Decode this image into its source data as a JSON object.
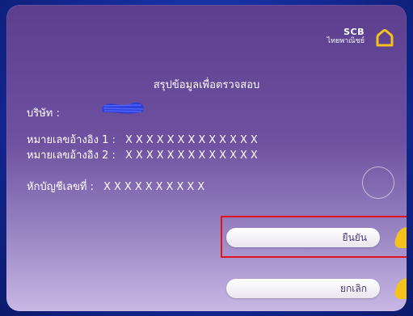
{
  "brand": {
    "name": "SCB",
    "thai_name": "ไทยพาณิชย์",
    "logo_icon": "house-icon"
  },
  "title": "สรุปข้อมูลเพื่อตรวจสอบ",
  "fields": {
    "company_label": "บริษัท :",
    "ref1_label": "หมายเลขอ้างอิง 1 :",
    "ref1_value": "XXXXXXXXXXXXX",
    "ref2_label": "หมายเลขอ้างอิง 2 :",
    "ref2_value": "XXXXXXXXXXXXX",
    "account_label": "หักบัญชีเลขที่ :",
    "account_value": "XXXXXXXXXX"
  },
  "buttons": {
    "confirm_label": "ยืนยัน",
    "cancel_label": "ยกเลิก"
  },
  "colors": {
    "accent_yellow": "#f5c21b",
    "highlight_red": "#e0151b",
    "screen_purple": "#5b3f8e"
  }
}
